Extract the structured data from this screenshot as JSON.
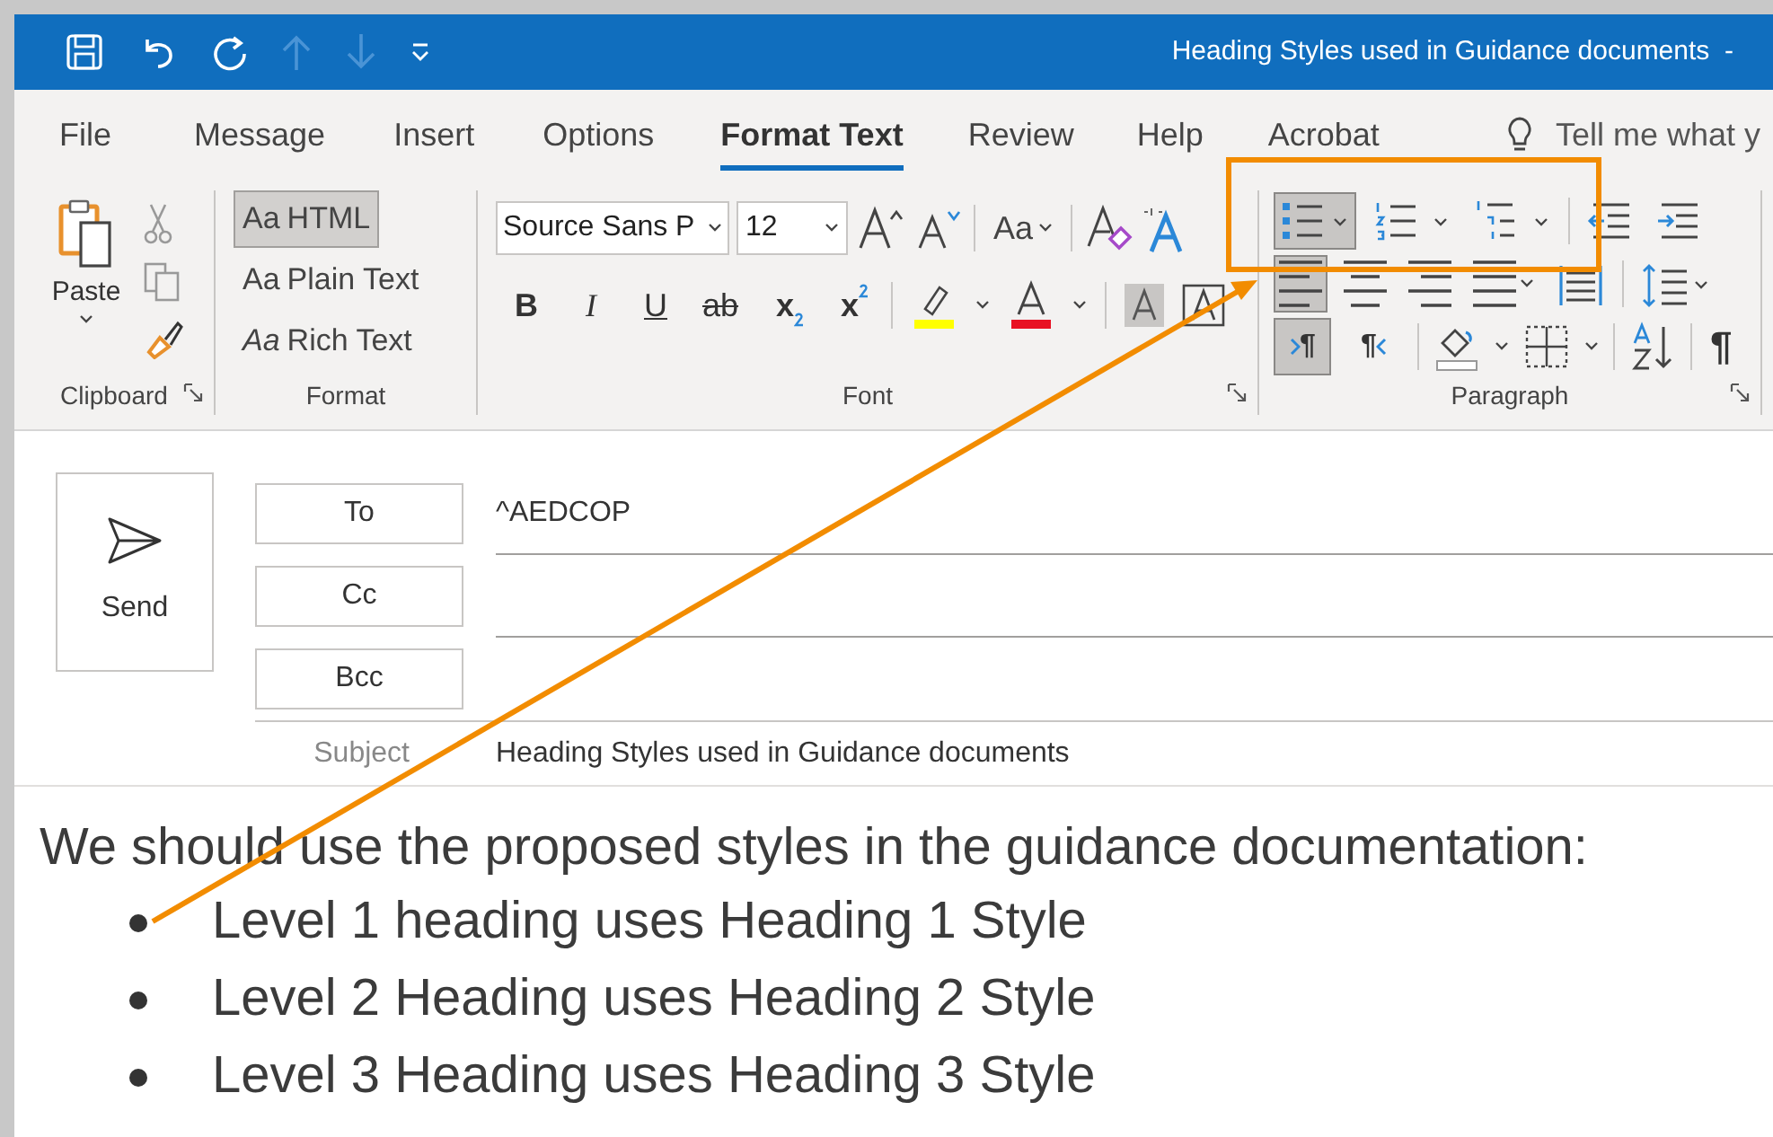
{
  "window": {
    "title": "Heading Styles used in Guidance documents  -"
  },
  "menu_tabs": [
    {
      "label": "File",
      "selected": false
    },
    {
      "label": "Message",
      "selected": false
    },
    {
      "label": "Insert",
      "selected": false
    },
    {
      "label": "Options",
      "selected": false
    },
    {
      "label": "Format Text",
      "selected": true
    },
    {
      "label": "Review",
      "selected": false
    },
    {
      "label": "Help",
      "selected": false
    },
    {
      "label": "Acrobat",
      "selected": false
    }
  ],
  "tell_me": {
    "placeholder": "Tell me what y"
  },
  "clipboard": {
    "paste": "Paste",
    "label": "Clipboard"
  },
  "format": {
    "options": [
      {
        "glyph": "Aa",
        "label": "HTML",
        "selected": true
      },
      {
        "glyph": "Aa",
        "label": "Plain Text",
        "selected": false
      },
      {
        "glyph": "Aa",
        "label": "Rich Text",
        "selected": false
      }
    ],
    "label": "Format"
  },
  "font": {
    "font_name": "Source Sans P",
    "font_size": "12",
    "change_case": "Aa",
    "bold": "B",
    "italic": "I",
    "underline": "U",
    "strikethrough": "ab",
    "subscript": "x",
    "superscript": "x",
    "label": "Font"
  },
  "paragraph": {
    "row1": [
      {
        "kind": "bullets",
        "selected": true
      },
      {
        "kind": "numbering",
        "selected": false
      },
      {
        "kind": "multilevel",
        "selected": false
      },
      {
        "kind": "outdent",
        "selected": false
      },
      {
        "kind": "indent",
        "selected": false
      }
    ],
    "row2": [
      {
        "kind": "align-left",
        "selected": true
      },
      {
        "kind": "align-center",
        "selected": false
      },
      {
        "kind": "align-right",
        "selected": false
      },
      {
        "kind": "justify",
        "selected": false
      },
      {
        "kind": "columns",
        "selected": false
      },
      {
        "kind": "spacing",
        "selected": false
      }
    ],
    "ltr": {
      "glyph": "¶",
      "selected": true
    },
    "rtl": {
      "glyph": "¶",
      "selected": false
    },
    "show_marks": "¶",
    "label": "Paragraph"
  },
  "compose": {
    "send": "Send",
    "to": "To",
    "to_value": "^AEDCOP",
    "cc": "Cc",
    "bcc": "Bcc",
    "subject_label": "Subject",
    "subject": "Heading Styles used in Guidance documents"
  },
  "body": {
    "intro": "We should use the proposed styles in the guidance documentation:",
    "bullets": [
      "Level 1 heading uses Heading 1 Style",
      "Level 2 Heading uses Heading 2 Style",
      "Level 3 Heading uses Heading 3 Style"
    ]
  }
}
